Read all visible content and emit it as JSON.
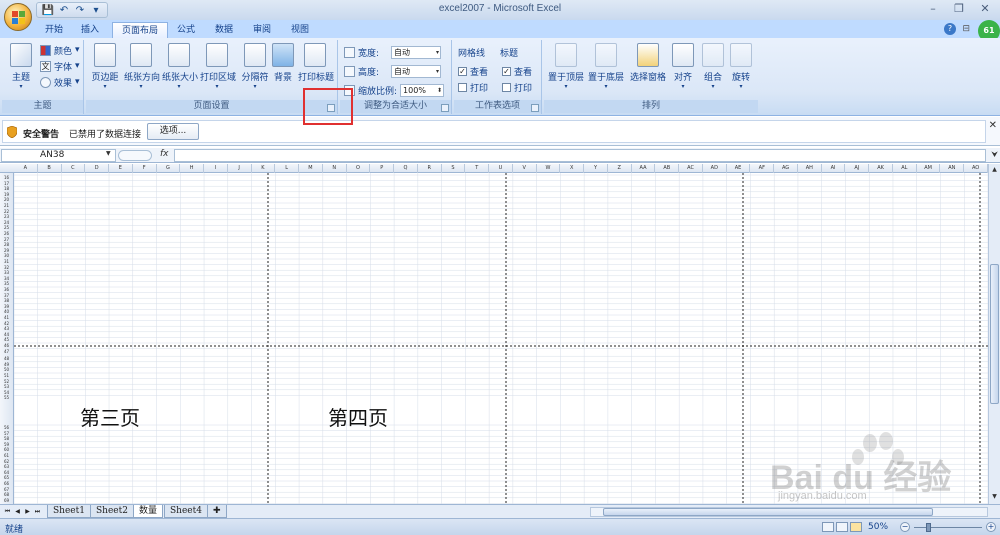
{
  "window": {
    "title": "excel2007 - Microsoft Excel",
    "minimize": "–",
    "restore": "❐",
    "close": "✕"
  },
  "qat": {
    "save": "💾",
    "undo": "↶",
    "redo": "↷",
    "customize": "▾"
  },
  "tabs": [
    {
      "label": "开始"
    },
    {
      "label": "插入"
    },
    {
      "label": "页面布局"
    },
    {
      "label": "公式"
    },
    {
      "label": "数据"
    },
    {
      "label": "审阅"
    },
    {
      "label": "视图"
    }
  ],
  "active_tab": "页面布局",
  "help": "?",
  "badge": "61",
  "ribbon": {
    "theme_group": {
      "label": "主题",
      "themes_btn": "主题",
      "colors": "颜色",
      "fonts": "字体",
      "effects": "效果"
    },
    "page_setup_group": {
      "label": "页面设置",
      "buttons": [
        "页边距",
        "纸张方向",
        "纸张大小",
        "打印区域",
        "分隔符",
        "背景",
        "打印标题"
      ]
    },
    "scale_group": {
      "label": "调整为合适大小",
      "width_label": "宽度:",
      "width_value": "自动",
      "height_label": "高度:",
      "height_value": "自动",
      "scale_label": "缩放比例:",
      "scale_value": "100%"
    },
    "sheet_options_group": {
      "label": "工作表选项",
      "gridlines_title": "网格线",
      "gridlines_view": "查看",
      "gridlines_print": "打印",
      "headings_title": "标题",
      "headings_view": "查看",
      "headings_print": "打印"
    },
    "arrange_group": {
      "label": "排列",
      "buttons": [
        "置于顶层",
        "置于底层",
        "选择窗格",
        "对齐",
        "组合",
        "旋转"
      ]
    }
  },
  "security": {
    "title": "安全警告",
    "message": "已禁用了数据连接",
    "options_btn": "选项..."
  },
  "formula_bar": {
    "name_box": "AN38",
    "fx": "fx",
    "value": ""
  },
  "sheet": {
    "col_headers": [
      "A",
      "B",
      "C",
      "D",
      "E",
      "F",
      "G",
      "H",
      "I",
      "J",
      "K",
      "L",
      "M",
      "N",
      "O",
      "P",
      "Q",
      "R",
      "S",
      "T",
      "U",
      "V",
      "W",
      "X",
      "Y",
      "Z",
      "AA",
      "AB",
      "AC",
      "AD",
      "AE",
      "AF",
      "AG",
      "AH",
      "AI",
      "AJ",
      "AK",
      "AL",
      "AM",
      "AN",
      "AO"
    ],
    "row_headers_top": [
      "16",
      "17",
      "18",
      "19",
      "20",
      "21",
      "22",
      "23",
      "24",
      "25",
      "26",
      "27",
      "28",
      "29",
      "30",
      "31",
      "32",
      "33",
      "34",
      "35",
      "36",
      "37",
      "38",
      "39",
      "40",
      "41",
      "42",
      "43",
      "44",
      "45",
      "46",
      "47"
    ],
    "row_headers_bottom": [
      "48",
      "49",
      "50",
      "51",
      "52",
      "53",
      "54",
      "55",
      "56",
      "57",
      "58",
      "59",
      "60",
      "61",
      "62",
      "63",
      "64",
      "65",
      "66",
      "67",
      "68",
      "69"
    ],
    "page3": "第三页",
    "page4": "第四页"
  },
  "sheet_tabs": [
    {
      "label": "Sheet1"
    },
    {
      "label": "Sheet2"
    },
    {
      "label": "数量"
    },
    {
      "label": "Sheet4"
    }
  ],
  "active_sheet": "数量",
  "status": {
    "ready": "就绪",
    "zoom": "50%"
  },
  "watermark": {
    "main": "Bai du 经验",
    "sub": "jingyan.baidu.com"
  }
}
